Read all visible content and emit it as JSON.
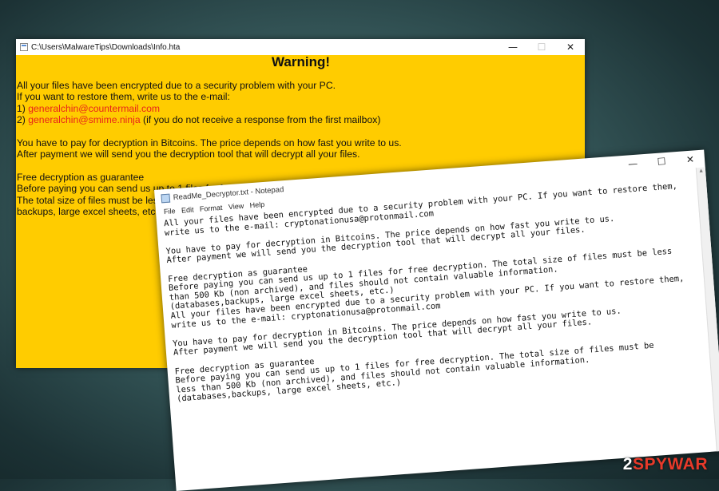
{
  "hta_window": {
    "title": "C:\\Users\\MalwareTips\\Downloads\\Info.hta",
    "buttons": {
      "minimize": "—",
      "maximize": "☐",
      "close": "✕"
    },
    "heading": "Warning!",
    "line1": "All your files have been encrypted due to a security problem with your PC.",
    "line2": "If you want to restore them, write us to the e-mail:",
    "email1_prefix": "1) ",
    "email1": "generalchin@countermail.com",
    "email2_prefix": "2) ",
    "email2": "generalchin@smime.ninja",
    "email2_suffix": " (if you do not receive a response from the first mailbox)",
    "line3": "You have to pay for decryption in Bitcoins. The price depends on how fast you write to us.",
    "line4": "After payment we will send you the decryption tool that will decrypt all your files.",
    "line5": "Free decryption as guarantee",
    "line6": "Before paying you can send us up to 1 files for free decryption.",
    "line7": "The total size of files must be less than 500 Kb (non archived), and files should not contain valuable information. (databases,",
    "line8": "backups, large excel sheets, etc.)"
  },
  "notepad_window": {
    "title": "ReadMe_Decryptor.txt - Notepad",
    "buttons": {
      "minimize": "—",
      "maximize": "☐",
      "close": "✕"
    },
    "menu": [
      "File",
      "Edit",
      "Format",
      "View",
      "Help"
    ],
    "lines": [
      "All your files have been encrypted due to a security problem with your PC. If you want to restore them,",
      "write us to the e-mail: cryptonationusa@protonmail.com",
      "",
      "You have to pay for decryption in Bitcoins. The price depends on how fast you write to us.",
      "After payment we will send you the decryption tool that will decrypt all your files.",
      "",
      "Free decryption as guarantee",
      "Before paying you can send us up to 1 files for free decryption. The total size of files must be less",
      "than 500 Kb (non archived), and files should not contain valuable information.",
      "(databases,backups, large excel sheets, etc.)",
      "All your files have been encrypted due to a security problem with your PC. If you want to restore them,",
      "write us to the e-mail: cryptonationusa@protonmail.com",
      "",
      "You have to pay for decryption in Bitcoins. The price depends on how fast you write to us.",
      "After payment we will send you the decryption tool that will decrypt all your files.",
      "",
      "Free decryption as guarantee",
      "Before paying you can send us up to 1 files for free decryption. The total size of files must be",
      "less than 500 Kb (non archived), and files should not contain valuable information.",
      "(databases,backups, large excel sheets, etc.)"
    ]
  },
  "watermark": {
    "prefix": "2",
    "accent": "SPYWAR",
    "colors": {
      "accent": "#e83a2a",
      "text": "#ffffff"
    }
  },
  "colors": {
    "hta_background": "#ffcc00",
    "email_red": "#e8231a"
  }
}
